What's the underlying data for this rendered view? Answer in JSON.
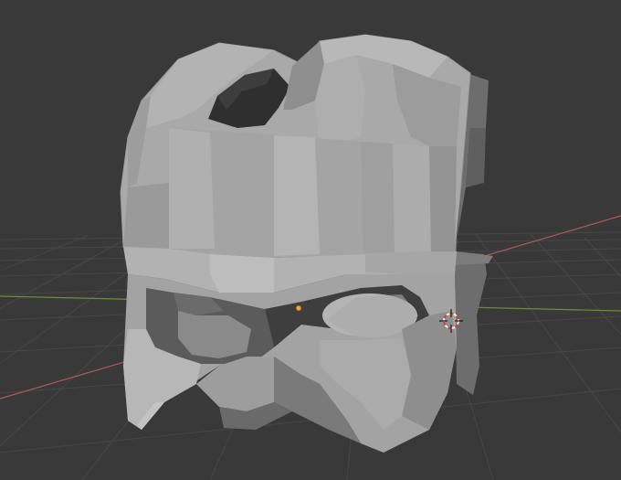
{
  "viewport": {
    "background_color": "#393939",
    "grid_line_color": "#4a4a4a",
    "x_axis_color": "#c45a63",
    "y_axis_color": "#7fa040",
    "origin_dot_color": "#f2a23a",
    "cursor_ring_colors": [
      "#d63a3a",
      "#f0f0f0"
    ]
  },
  "mesh": {
    "name": "helmet",
    "base_color": "#a7a7a7",
    "shading": "solid-flat"
  },
  "icons": {
    "origin": "origin-dot-icon",
    "cursor": "3d-cursor-icon"
  }
}
